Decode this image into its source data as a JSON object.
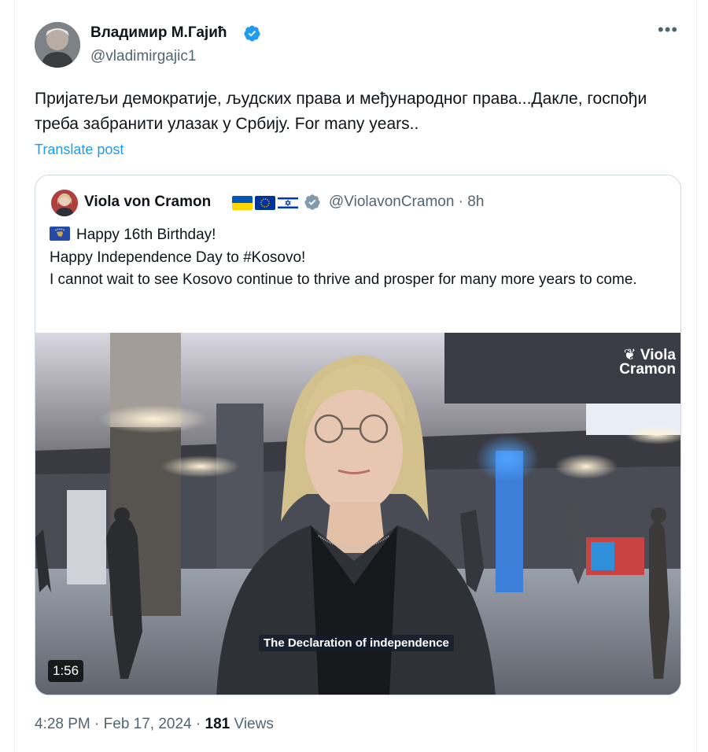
{
  "tweet": {
    "author_name": "Владимир М.Гајић",
    "author_handle": "@vladimirgajic1",
    "verified_icon": "verified-badge-icon",
    "more_icon": "more-icon",
    "more_label": "•••",
    "text": "Пријатељи демократије, људских права и међународног права...Дакле, госпођи треба забранити улазак у Србију. For many years..",
    "translate_label": "Translate post",
    "timestamp": "4:28 PM · Feb 17, 2024 · ",
    "views_count": "181",
    "views_label": " Views"
  },
  "quote": {
    "author_name": "Viola von Cramon",
    "flags": [
      "ukraine-flag-icon",
      "eu-flag-icon",
      "israel-flag-icon"
    ],
    "handle_time": "@ViolavonCramon · 8h",
    "line1": "Happy 16th Birthday!",
    "line2": "Happy Independence Day to #Kosovo!",
    "line3": "I cannot wait to see Kosovo continue to thrive and prosper for many more years to come.",
    "video": {
      "logo_line1": "❦ Viola",
      "logo_line2": "Cramon",
      "caption": "The Declaration of independence",
      "duration": "1:56"
    }
  },
  "colors": {
    "accent": "#1d9bf0",
    "secondary_text": "#536471",
    "border": "#cfd9de"
  }
}
